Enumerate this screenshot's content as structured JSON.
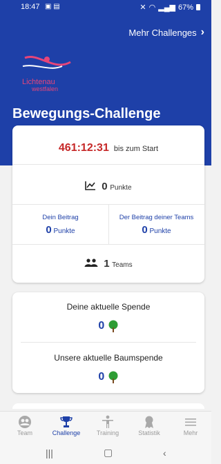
{
  "status": {
    "time": "18:47",
    "battery": "67%"
  },
  "header": {
    "more_challenges": "Mehr Challenges"
  },
  "logo": {
    "line1": "Lichtenau",
    "line2": "westfalen"
  },
  "page": {
    "title": "Bewegungs-Challenge"
  },
  "stats": {
    "countdown": "461:12:31",
    "countdown_suffix": "bis zum Start",
    "points_value": "0",
    "points_unit": "Punkte",
    "your_contribution_label": "Dein Beitrag",
    "your_contribution_value": "0",
    "your_contribution_unit": "Punkte",
    "team_contribution_label": "Der Beitrag deiner Teams",
    "team_contribution_value": "0",
    "team_contribution_unit": "Punkte",
    "teams_value": "1",
    "teams_unit": "Teams"
  },
  "donations": {
    "current_label": "Deine aktuelle Spende",
    "current_value": "0",
    "tree_label": "Unsere aktuelle Baumspende",
    "tree_value": "0"
  },
  "nav": {
    "items": [
      {
        "label": "Team",
        "icon": "team-icon"
      },
      {
        "label": "Challenge",
        "icon": "trophy-icon"
      },
      {
        "label": "Training",
        "icon": "person-icon"
      },
      {
        "label": "Statistik",
        "icon": "medal-icon"
      },
      {
        "label": "Mehr",
        "icon": "menu-icon"
      }
    ],
    "active": "Challenge"
  },
  "colors": {
    "primary": "#1e40a8",
    "countdown": "#c62828",
    "tree": "#2e9d34"
  }
}
